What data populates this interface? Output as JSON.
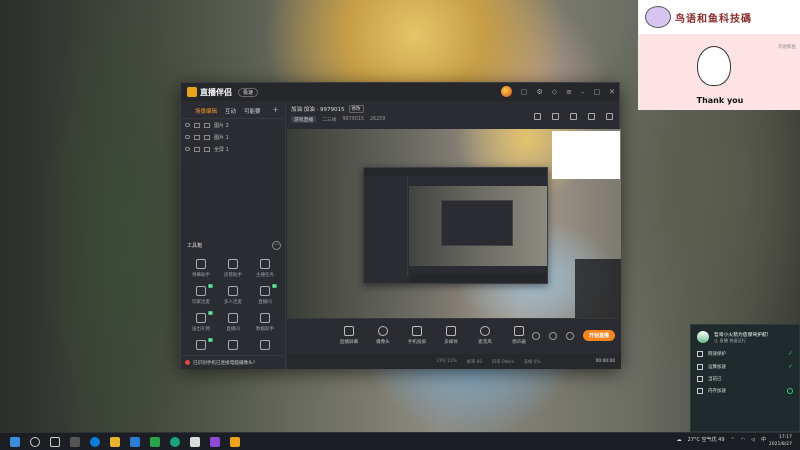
{
  "app": {
    "name": "直播伴侣",
    "badge": "极速",
    "header": {
      "title_line": "加油 加油 · 9979015",
      "edit_tag": "修改",
      "chips": [
        "游戏直播",
        "二三线",
        "9979015",
        "26259"
      ]
    },
    "left_tabs": [
      {
        "label": "场景编辑",
        "active": true
      },
      {
        "label": "互动",
        "active": false
      },
      {
        "label": "可能要",
        "active": false
      }
    ],
    "scenes": [
      {
        "label": "图片 2"
      },
      {
        "label": "图片 1"
      },
      {
        "label": "全屏 1"
      }
    ],
    "tools_title": "工具箱",
    "tools": [
      {
        "label": "弹幕助手",
        "badge": ""
      },
      {
        "label": "房管助手",
        "badge": ""
      },
      {
        "label": "主播任务",
        "badge": ""
      },
      {
        "label": "玩家连麦",
        "badge": "新"
      },
      {
        "label": "多人连麦",
        "badge": ""
      },
      {
        "label": "直播间",
        "badge": "新"
      },
      {
        "label": "送出礼物",
        "badge": "新"
      },
      {
        "label": "直播间",
        "badge": ""
      },
      {
        "label": "数据助手",
        "badge": ""
      },
      {
        "label": "",
        "badge": "新"
      },
      {
        "label": "",
        "badge": ""
      },
      {
        "label": "",
        "badge": ""
      }
    ],
    "left_bottom_tip": "已识别手机已连接电脑摄像头?",
    "bottom_bar": [
      {
        "label": "直播屏幕",
        "icon": "screen-icon"
      },
      {
        "label": "摄像头",
        "icon": "camera-icon"
      },
      {
        "label": "手机投屏",
        "icon": "phone-cast-icon"
      },
      {
        "label": "多媒体",
        "icon": "media-icon"
      },
      {
        "label": "麦克风",
        "icon": "microphone-icon"
      },
      {
        "label": "扬声器",
        "icon": "speaker-icon"
      }
    ],
    "go_live": "开始直播",
    "status": {
      "cpu": "CPU 12%",
      "fps": "帧率 60",
      "bitrate": "码率 0kb/s",
      "drop": "丢帧 0%",
      "timer": "00:00:00"
    }
  },
  "sticker": {
    "title": "鸟语和鱼科技碼",
    "tag": "鸟语和鱼",
    "caption": "Thank you"
  },
  "notification": {
    "title": "哲哥小火箭为您保驾护航!",
    "subtitle": "让 直播 快速运行",
    "items": [
      {
        "label": "网速保护",
        "status": "ok"
      },
      {
        "label": "运算加速",
        "status": "ok"
      },
      {
        "label": "当前已",
        "status": "none"
      },
      {
        "label": "内存加速",
        "status": "progress"
      }
    ]
  },
  "taskbar": {
    "weather": "27°C 空气优 49",
    "time": "17:17",
    "date": "2021/8/27"
  }
}
